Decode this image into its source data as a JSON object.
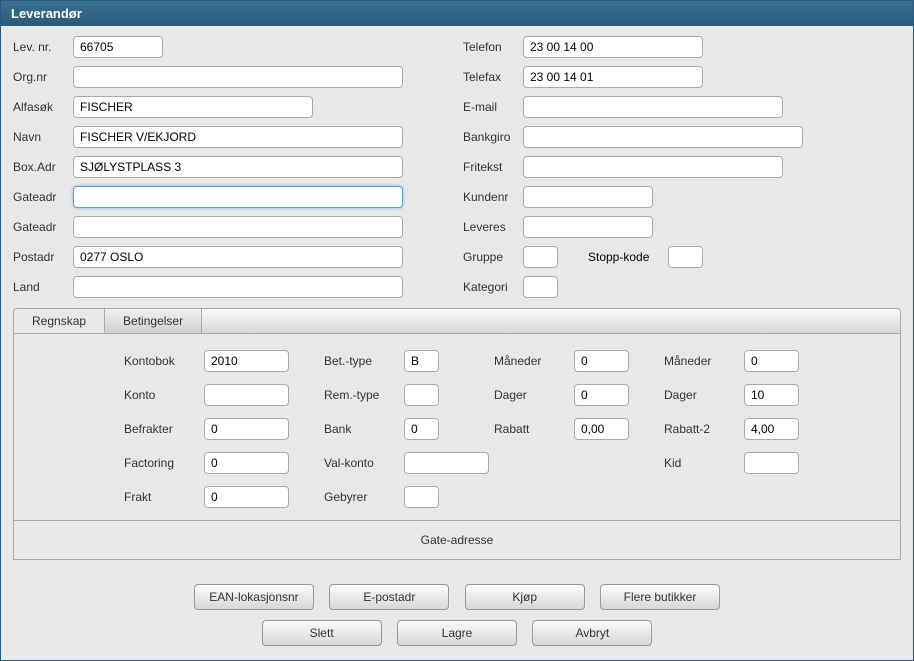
{
  "title": "Leverandør",
  "left": {
    "levnr": {
      "label": "Lev. nr.",
      "value": "66705"
    },
    "orgnr": {
      "label": "Org.nr",
      "value": ""
    },
    "alfasok": {
      "label": "Alfasøk",
      "value": "FISCHER"
    },
    "navn": {
      "label": "Navn",
      "value": "FISCHER V/EKJORD"
    },
    "boxadr": {
      "label": "Box.Adr",
      "value": "SJØLYSTPLASS 3"
    },
    "gateadr1": {
      "label": "Gateadr",
      "value": ""
    },
    "gateadr2": {
      "label": "Gateadr",
      "value": ""
    },
    "postadr": {
      "label": "Postadr",
      "value": "0277 OSLO"
    },
    "land": {
      "label": "Land",
      "value": ""
    }
  },
  "right": {
    "telefon": {
      "label": "Telefon",
      "value": "23 00 14 00"
    },
    "telefax": {
      "label": "Telefax",
      "value": "23 00 14 01"
    },
    "email": {
      "label": "E-mail",
      "value": ""
    },
    "bankgiro": {
      "label": "Bankgiro",
      "value": ""
    },
    "fritekst": {
      "label": "Fritekst",
      "value": ""
    },
    "kundenr": {
      "label": "Kundenr",
      "value": ""
    },
    "leveres": {
      "label": "Leveres",
      "value": ""
    },
    "gruppe": {
      "label": "Gruppe",
      "value": ""
    },
    "stoppkode": {
      "label": "Stopp-kode",
      "value": ""
    },
    "kategori": {
      "label": "Kategori",
      "value": ""
    }
  },
  "tabs": [
    {
      "label": "Regnskap",
      "active": true
    },
    {
      "label": "Betingelser",
      "active": false
    }
  ],
  "regnskap": {
    "kontobok": {
      "label": "Kontobok",
      "value": "2010"
    },
    "konto": {
      "label": "Konto",
      "value": ""
    },
    "befrakter": {
      "label": "Befrakter",
      "value": "0"
    },
    "factoring": {
      "label": "Factoring",
      "value": "0"
    },
    "frakt": {
      "label": "Frakt",
      "value": "0"
    },
    "bettype": {
      "label": "Bet.-type",
      "value": "B"
    },
    "remtype": {
      "label": "Rem.-type",
      "value": ""
    },
    "bank": {
      "label": "Bank",
      "value": "0"
    },
    "valkonto": {
      "label": "Val-konto",
      "value": ""
    },
    "gebyrer": {
      "label": "Gebyrer",
      "value": ""
    },
    "maneder1": {
      "label": "Måneder",
      "value": "0"
    },
    "dager1": {
      "label": "Dager",
      "value": "0"
    },
    "rabatt": {
      "label": "Rabatt",
      "value": "0,00"
    },
    "maneder2": {
      "label": "Måneder",
      "value": "0"
    },
    "dager2": {
      "label": "Dager",
      "value": "10"
    },
    "rabatt2": {
      "label": "Rabatt-2",
      "value": "4,00"
    },
    "kid": {
      "label": "Kid",
      "value": ""
    }
  },
  "section": {
    "gateadresse": "Gate-adresse"
  },
  "buttons": {
    "ean": "EAN-lokasjonsnr",
    "epost": "E-postadr",
    "kjop": "Kjøp",
    "flere": "Flere butikker",
    "slett": "Slett",
    "lagre": "Lagre",
    "avbryt": "Avbryt"
  }
}
